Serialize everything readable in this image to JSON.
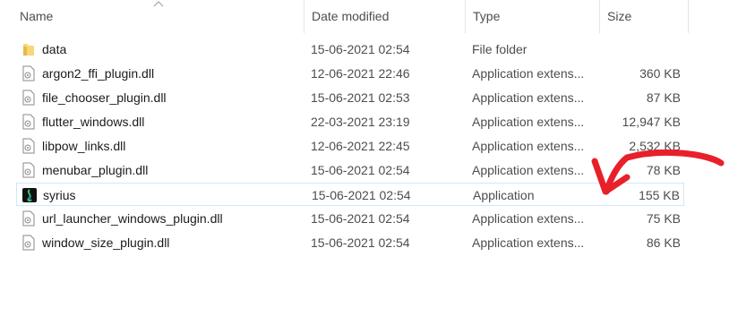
{
  "columns": {
    "name": "Name",
    "date_modified": "Date modified",
    "type": "Type",
    "size": "Size"
  },
  "files": [
    {
      "name": "data",
      "date": "15-06-2021 02:54",
      "type": "File folder",
      "size": "",
      "icon": "folder-icon"
    },
    {
      "name": "argon2_ffi_plugin.dll",
      "date": "12-06-2021 22:46",
      "type": "Application extens...",
      "size": "360 KB",
      "icon": "dll-file-icon"
    },
    {
      "name": "file_chooser_plugin.dll",
      "date": "15-06-2021 02:53",
      "type": "Application extens...",
      "size": "87 KB",
      "icon": "dll-file-icon"
    },
    {
      "name": "flutter_windows.dll",
      "date": "22-03-2021 23:19",
      "type": "Application extens...",
      "size": "12,947 KB",
      "icon": "dll-file-icon"
    },
    {
      "name": "libpow_links.dll",
      "date": "12-06-2021 22:45",
      "type": "Application extens...",
      "size": "2,532 KB",
      "icon": "dll-file-icon"
    },
    {
      "name": "menubar_plugin.dll",
      "date": "15-06-2021 02:54",
      "type": "Application extens...",
      "size": "78 KB",
      "icon": "dll-file-icon"
    },
    {
      "name": "syrius",
      "date": "15-06-2021 02:54",
      "type": "Application",
      "size": "155 KB",
      "icon": "syrius-app-icon"
    },
    {
      "name": "url_launcher_windows_plugin.dll",
      "date": "15-06-2021 02:54",
      "type": "Application extens...",
      "size": "75 KB",
      "icon": "dll-file-icon"
    },
    {
      "name": "window_size_plugin.dll",
      "date": "15-06-2021 02:54",
      "type": "Application extens...",
      "size": "86 KB",
      "icon": "dll-file-icon"
    }
  ],
  "annotation": {
    "color": "#e8202a",
    "icon": "red-arrow-annotation"
  },
  "colors": {
    "selection_border": "#cde8ff",
    "folder": "#f8d775"
  }
}
